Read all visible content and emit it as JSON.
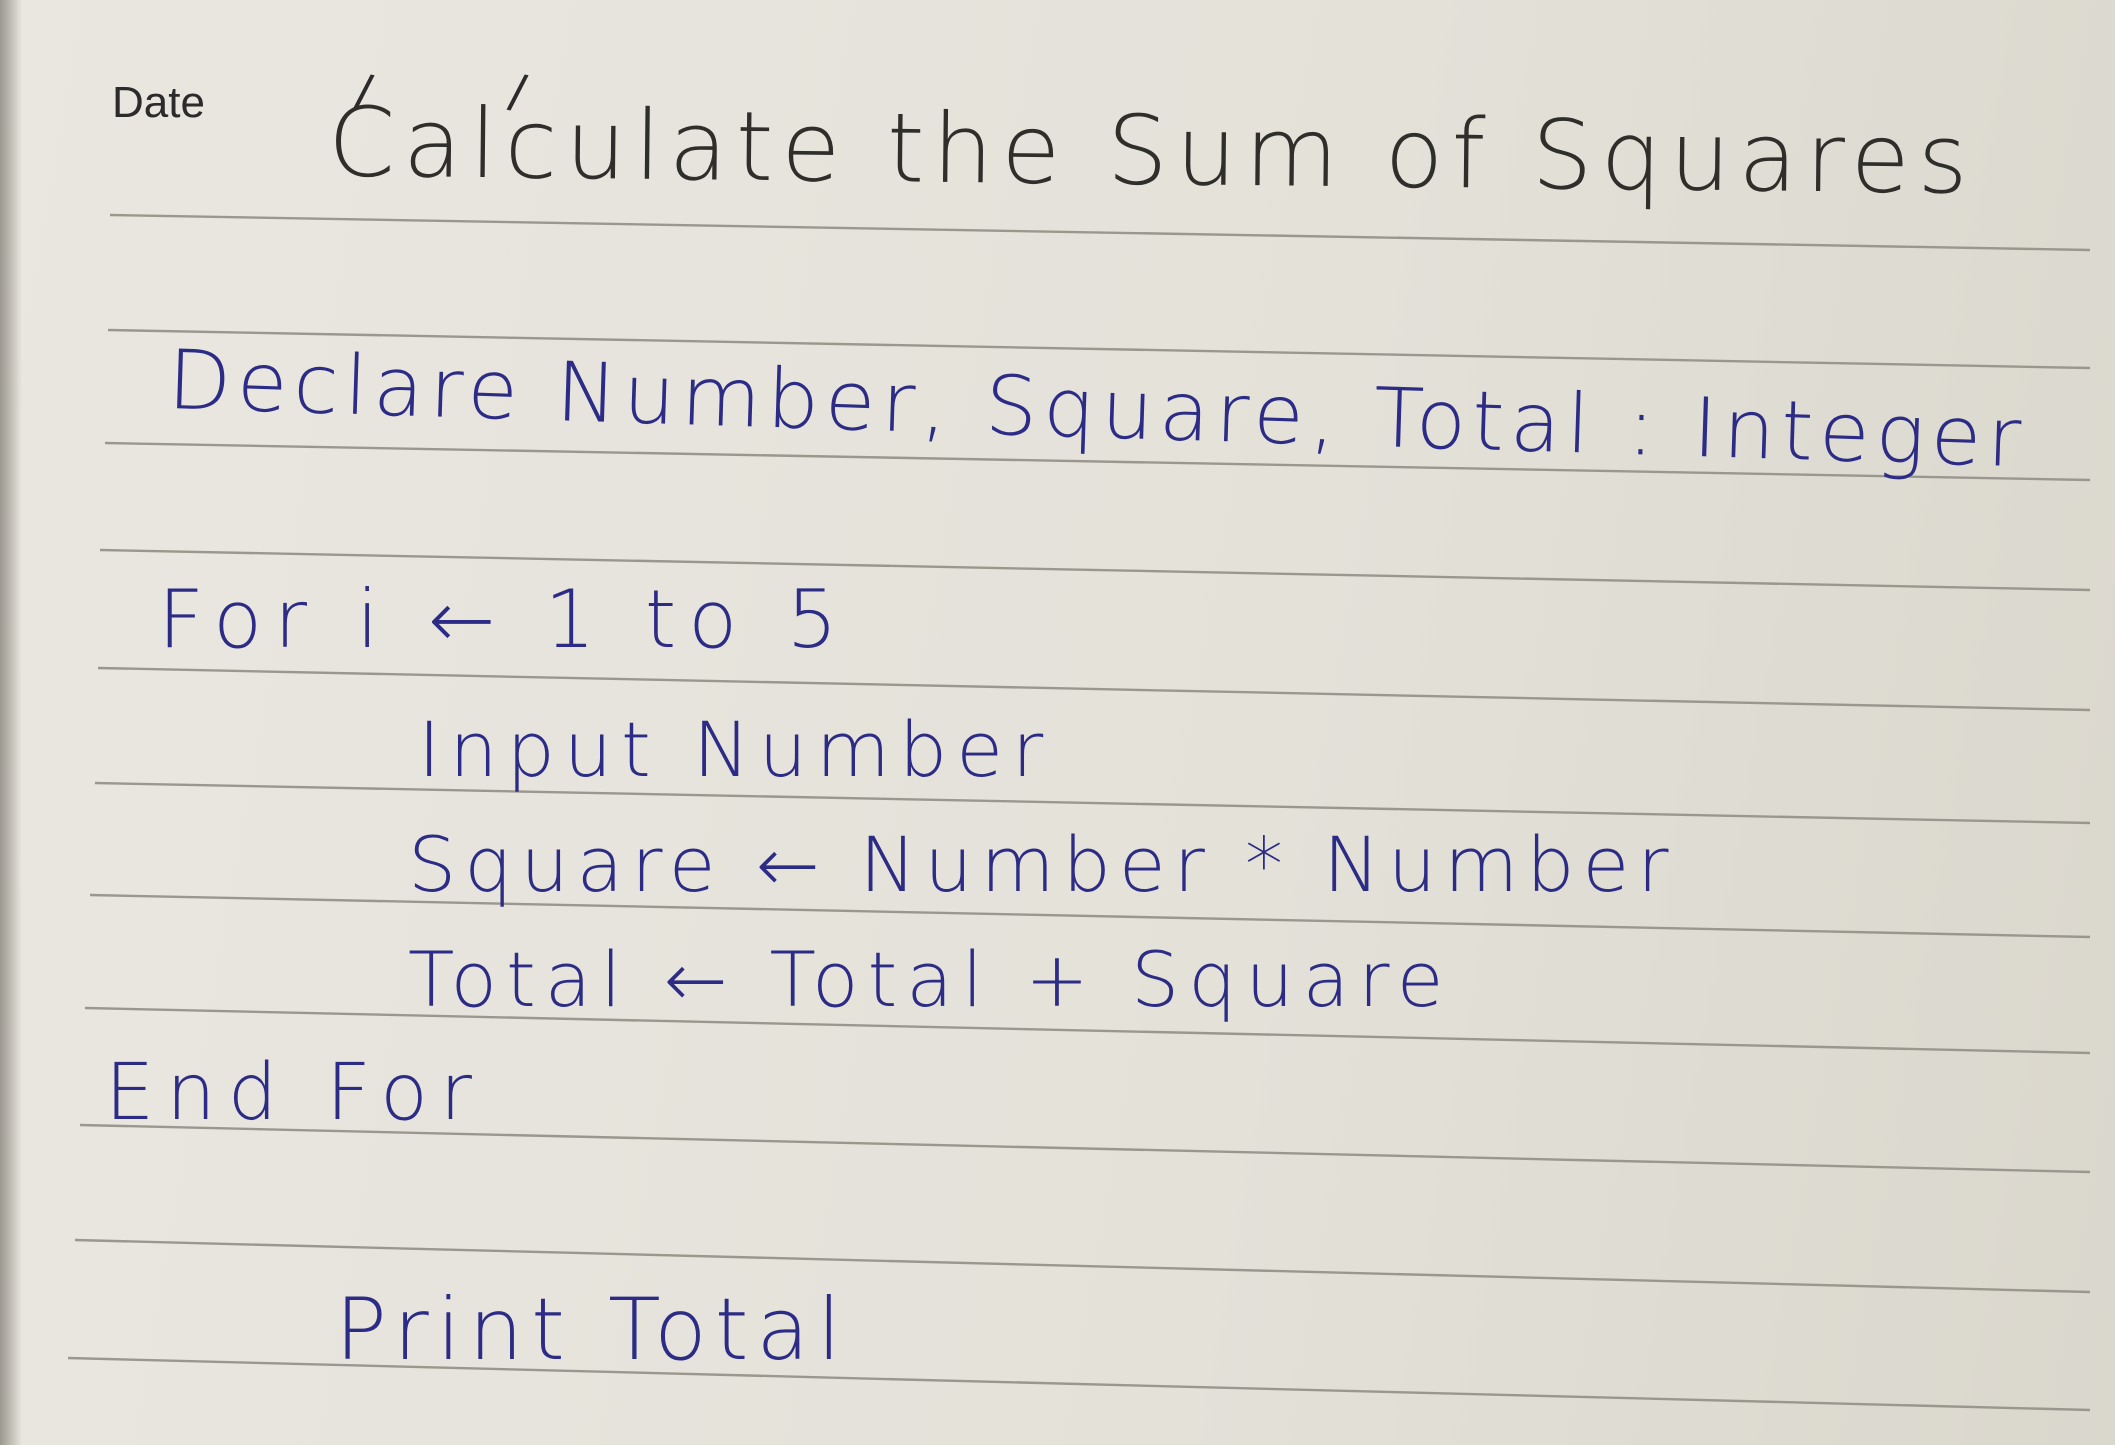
{
  "notebook": {
    "date_label": "Date",
    "date_separator_1": "/",
    "date_separator_2": "/"
  },
  "note": {
    "title": "Calculate the Sum of Squares",
    "lines": [
      "Declare Number, Square, Total : Integer",
      "For i ← 1 to 5",
      "Input Number",
      "Square ← Number * Number",
      "Total ← Total + Square",
      "End For",
      "Print Total"
    ]
  },
  "colors": {
    "paper": "#e6e4dc",
    "rule_line": "#9a978f",
    "pencil_ink": "#2f2e2b",
    "pen_ink": "#2c2c86"
  }
}
